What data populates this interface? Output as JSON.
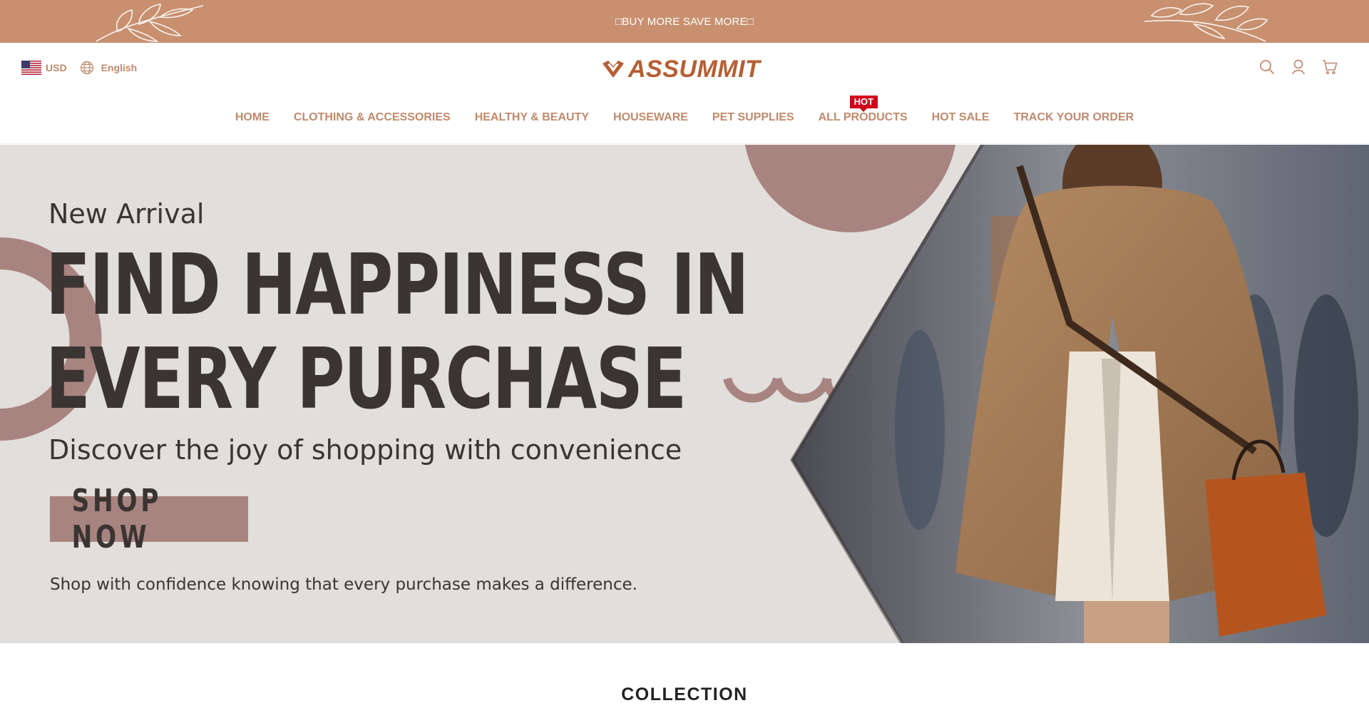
{
  "announcement": {
    "text": "BUY MORE SAVE MORE"
  },
  "header": {
    "currency": "USD",
    "language": "English",
    "logo_text": "ASSUMMIT",
    "icons": [
      "search-icon",
      "account-icon",
      "cart-icon"
    ]
  },
  "nav": {
    "items": [
      {
        "label": "HOME"
      },
      {
        "label": "CLOTHING & ACCESSORIES"
      },
      {
        "label": "HEALTHY & BEAUTY"
      },
      {
        "label": "HOUSEWARE"
      },
      {
        "label": "PET SUPPLIES"
      },
      {
        "label": "ALL PRODUCTS",
        "badge": "HOT"
      },
      {
        "label": "HOT SALE"
      },
      {
        "label": "TRACK YOUR ORDER"
      }
    ]
  },
  "hero": {
    "kicker": "New Arrival",
    "headline_line1": "FIND HAPPINESS IN",
    "headline_line2": "EVERY PURCHASE",
    "subheading": "Discover the joy of shopping with convenience",
    "cta": "SHOP NOW",
    "tagline": "Shop with confidence knowing that every purchase makes a difference."
  },
  "collection": {
    "title": "COLLECTION"
  },
  "colors": {
    "accent": "#c8906f",
    "nav_text": "#c08a6c",
    "logo": "#b55e34",
    "hot_badge": "#d0021b",
    "hero_bg": "#e1dedb",
    "hero_shape": "#a88480"
  }
}
